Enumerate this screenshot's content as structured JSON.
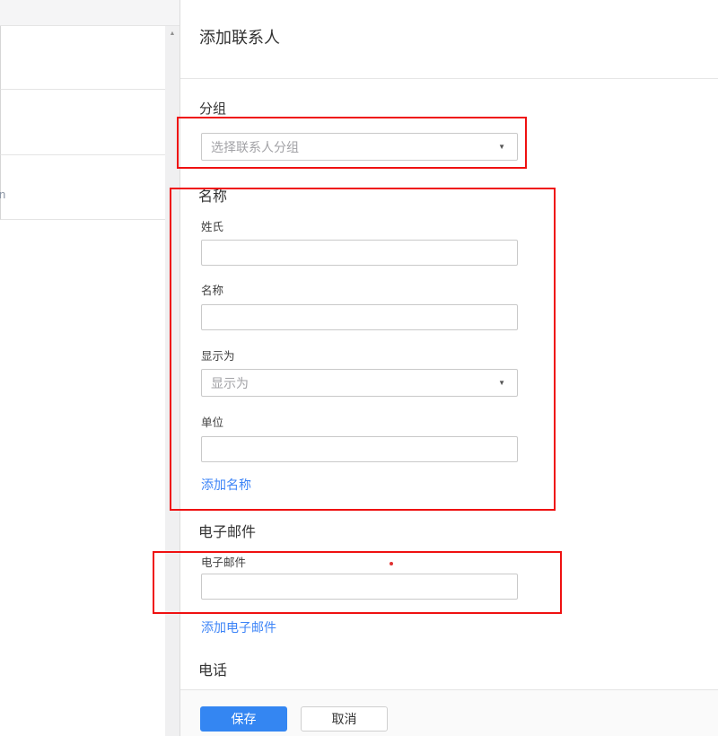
{
  "colors": {
    "primary_button": "#3486f2",
    "link": "#3d84f7",
    "annotation": "#ef1111"
  },
  "icons": {
    "dropdown_caret": "▼",
    "scroll_up_arrow": "▲"
  },
  "left_panel": {
    "truncated_text": "n"
  },
  "dialog": {
    "title": "添加联系人",
    "group": {
      "label": "分组",
      "placeholder": "选择联系人分组",
      "value": ""
    },
    "name": {
      "heading": "名称",
      "last_name": {
        "label": "姓氏",
        "value": ""
      },
      "first_name": {
        "label": "名称",
        "value": ""
      },
      "display_as": {
        "label": "显示为",
        "placeholder": "显示为",
        "value": ""
      },
      "company": {
        "label": "单位",
        "value": ""
      },
      "add_link": "添加名称"
    },
    "email": {
      "heading": "电子邮件",
      "field": {
        "label": "电子邮件",
        "value": ""
      },
      "add_link": "添加电子邮件"
    },
    "phone": {
      "heading": "电话"
    },
    "footer": {
      "save": "保存",
      "cancel": "取消"
    }
  }
}
